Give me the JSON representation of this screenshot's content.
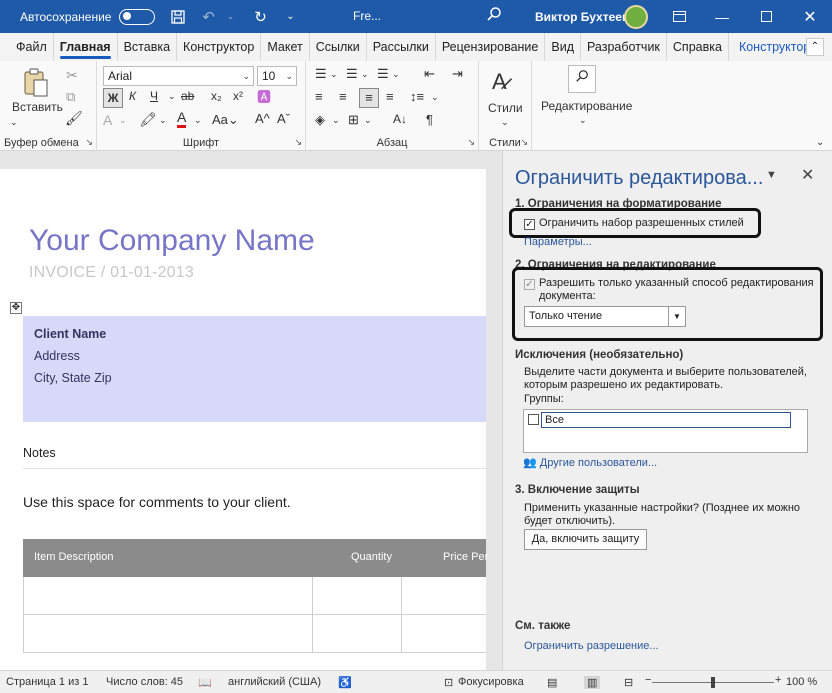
{
  "titlebar": {
    "autosave_label": "Автосохранение",
    "doc_title": "Fre...",
    "user_name": "Виктор Бухтеев"
  },
  "menu": {
    "tabs": [
      "Файл",
      "Главная",
      "Вставка",
      "Конструктор",
      "Макет",
      "Ссылки",
      "Рассылки",
      "Рецензирование",
      "Вид",
      "Разработчик",
      "Справка",
      "Конструктор"
    ],
    "active_tab": "Главная"
  },
  "ribbon": {
    "clipboard": {
      "paste_label": "Вставить",
      "group_label": "Буфер обмена"
    },
    "font": {
      "font_name": "Arial",
      "font_size": "10",
      "group_label": "Шрифт",
      "bold": "Ж",
      "italic": "К",
      "underline": "Ч"
    },
    "paragraph": {
      "group_label": "Абзац"
    },
    "styles": {
      "label": "Стили",
      "group_label": "Стили"
    },
    "editing": {
      "label": "Редактирование"
    }
  },
  "document": {
    "company_name": "Your Company Name",
    "invoice_line": "INVOICE / 01-01-2013",
    "client_name": "Client Name",
    "address": "Address",
    "city": "City, State Zip",
    "notes_label": "Notes",
    "comment_text": "Use this space for comments to your client.",
    "table_headers": [
      "Item Description",
      "Quantity",
      "Price Per"
    ]
  },
  "pane": {
    "title": "Ограничить редактирова...",
    "section1_title": "1. Ограничения на форматирование",
    "section1_checkbox": "Ограничить набор разрешенных стилей",
    "section1_link": "Параметры...",
    "section2_title": "2. Ограничения на редактирование",
    "section2_checkbox_line1": "Разрешить только указанный способ редактирования",
    "section2_checkbox_line2": "документа:",
    "section2_select": "Только чтение",
    "exceptions_title": "Исключения (необязательно)",
    "exceptions_desc_line1": "Выделите части документа и выберите пользователей,",
    "exceptions_desc_line2": "которым разрешено их редактировать.",
    "groups_label": "Группы:",
    "groups_entry": "Все",
    "other_users_link": "Другие пользователи...",
    "section3_title": "3. Включение защиты",
    "section3_desc_line1": "Применить указанные настройки? (Позднее их можно",
    "section3_desc_line2": "будет отключить).",
    "protect_button": "Да, включить защиту",
    "see_also_title": "См. также",
    "see_also_link": "Ограничить разрешение..."
  },
  "status": {
    "page": "Страница 1 из 1",
    "words": "Число слов: 45",
    "language": "английский (США)",
    "focus": "Фокусировка",
    "zoom": "100 %"
  },
  "colors": {
    "titlebar": "#1f5aa8",
    "accent": "#185abd",
    "company": "#7775c6",
    "client_box": "#d8d8f9",
    "table_header": "#8b8b8b"
  }
}
